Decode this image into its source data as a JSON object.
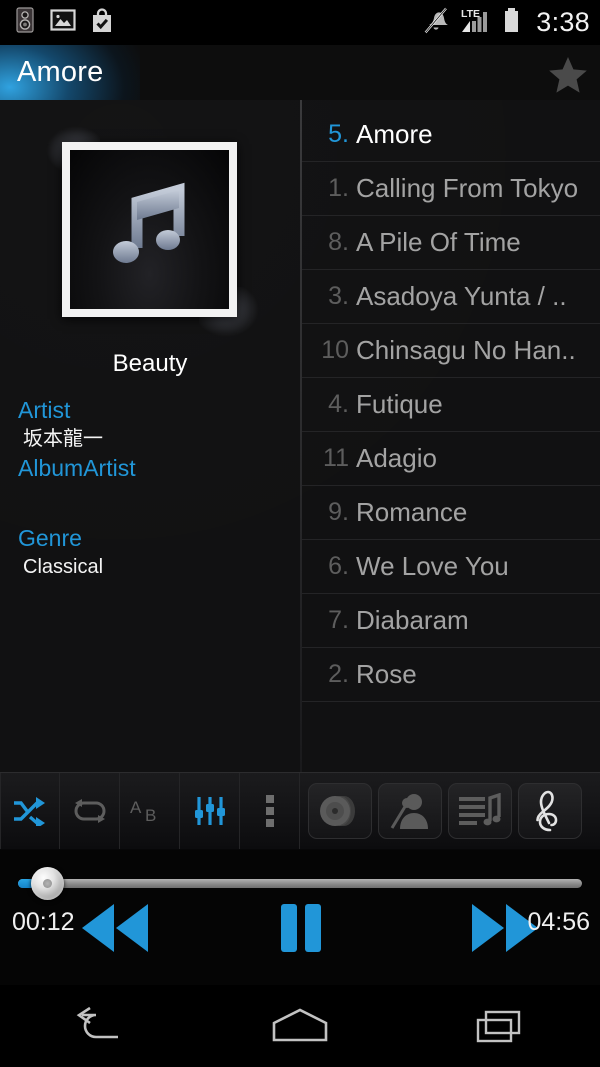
{
  "status_bar": {
    "icons_left": [
      "speaker-notification-icon",
      "photo-icon",
      "play-store-bag-check-icon"
    ],
    "icons_right": [
      "mute-icon",
      "lte-signal-icon",
      "battery-icon"
    ],
    "network_label": "LTE",
    "time": "3:38"
  },
  "title_bar": {
    "title": "Amore",
    "favorite_icon": "star-icon",
    "accent_color": "#2196d8"
  },
  "now_playing": {
    "album_art_icon": "music-note-icon",
    "album": "Beauty",
    "fields": [
      {
        "label": "Artist",
        "value": "坂本龍一"
      },
      {
        "label": "AlbumArtist",
        "value": ""
      },
      {
        "label": "Genre",
        "value": "Classical"
      }
    ]
  },
  "track_list": [
    {
      "num": "5.",
      "title": "Amore",
      "active": true
    },
    {
      "num": "1.",
      "title": "Calling From Tokyo",
      "active": false
    },
    {
      "num": "8.",
      "title": "A Pile Of Time",
      "active": false
    },
    {
      "num": "3.",
      "title": "Asadoya Yunta / ..",
      "active": false
    },
    {
      "num": "10",
      "title": "Chinsagu No Han..",
      "active": false
    },
    {
      "num": "4.",
      "title": "Futique",
      "active": false
    },
    {
      "num": "11",
      "title": "Adagio",
      "active": false
    },
    {
      "num": "9.",
      "title": "Romance",
      "active": false
    },
    {
      "num": "6.",
      "title": "We Love You",
      "active": false
    },
    {
      "num": "7.",
      "title": "Diabaram",
      "active": false
    },
    {
      "num": "2.",
      "title": "Rose",
      "active": false
    }
  ],
  "toolbar": {
    "buttons": [
      {
        "name": "shuffle-icon",
        "label": "Shuffle",
        "active": true
      },
      {
        "name": "repeat-icon",
        "label": "Repeat",
        "active": false
      },
      {
        "name": "ab-repeat-icon",
        "label": "A-B Repeat",
        "active": false
      },
      {
        "name": "equalizer-icon",
        "label": "Equalizer",
        "active": true
      },
      {
        "name": "overflow-menu-icon",
        "label": "More options",
        "active": false
      }
    ],
    "tabs": [
      {
        "name": "albums-tab-icon",
        "label": "Albums",
        "active": false
      },
      {
        "name": "artists-tab-icon",
        "label": "Artists",
        "active": false
      },
      {
        "name": "playlist-tab-icon",
        "label": "Playlist",
        "active": false
      },
      {
        "name": "treble-clef-tab-icon",
        "label": "Now Playing",
        "active": true
      }
    ]
  },
  "player": {
    "elapsed": "00:12",
    "duration": "04:56",
    "progress_percent": 4,
    "prev_label": "Rewind",
    "play_label": "Pause",
    "next_label": "Fast forward",
    "state": "playing"
  },
  "nav_bar": {
    "back_label": "Back",
    "home_label": "Home",
    "recents_label": "Recents"
  }
}
